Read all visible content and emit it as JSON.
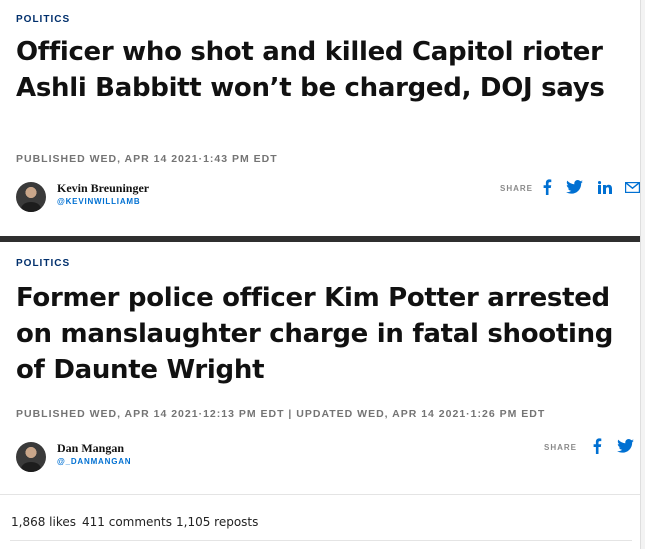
{
  "articles": [
    {
      "section": "POLITICS",
      "headline": "Officer who shot and killed Capitol rioter Ashli Babbitt won’t be charged, DOJ says",
      "published": "PUBLISHED WED, APR 14 2021·1:43 PM EDT",
      "author": {
        "name": "Kevin Breuninger",
        "handle": "@KEVINWILLIAMB"
      },
      "share_label": "SHARE",
      "share_icons": [
        "facebook-icon",
        "twitter-icon",
        "linkedin-icon",
        "email-icon"
      ]
    },
    {
      "section": "POLITICS",
      "headline": "Former police officer Kim Potter arrested on manslaughter charge in fatal shooting of Daunte Wright",
      "published": "PUBLISHED WED, APR 14 2021·12:13 PM EDT | UPDATED WED, APR 14 2021·1:26 PM EDT",
      "author": {
        "name": "Dan Mangan",
        "handle": "@_DANMANGAN"
      },
      "share_label": "SHARE",
      "share_icons": [
        "facebook-icon",
        "twitter-icon"
      ]
    }
  ],
  "social": {
    "likes": "1,868 likes",
    "comments": "411 comments",
    "reposts": "1,105 reposts"
  },
  "colors": {
    "section": "#002f6c",
    "handle": "#0070d2",
    "icon": "#0070d2",
    "divider": "#2f2f2f"
  }
}
